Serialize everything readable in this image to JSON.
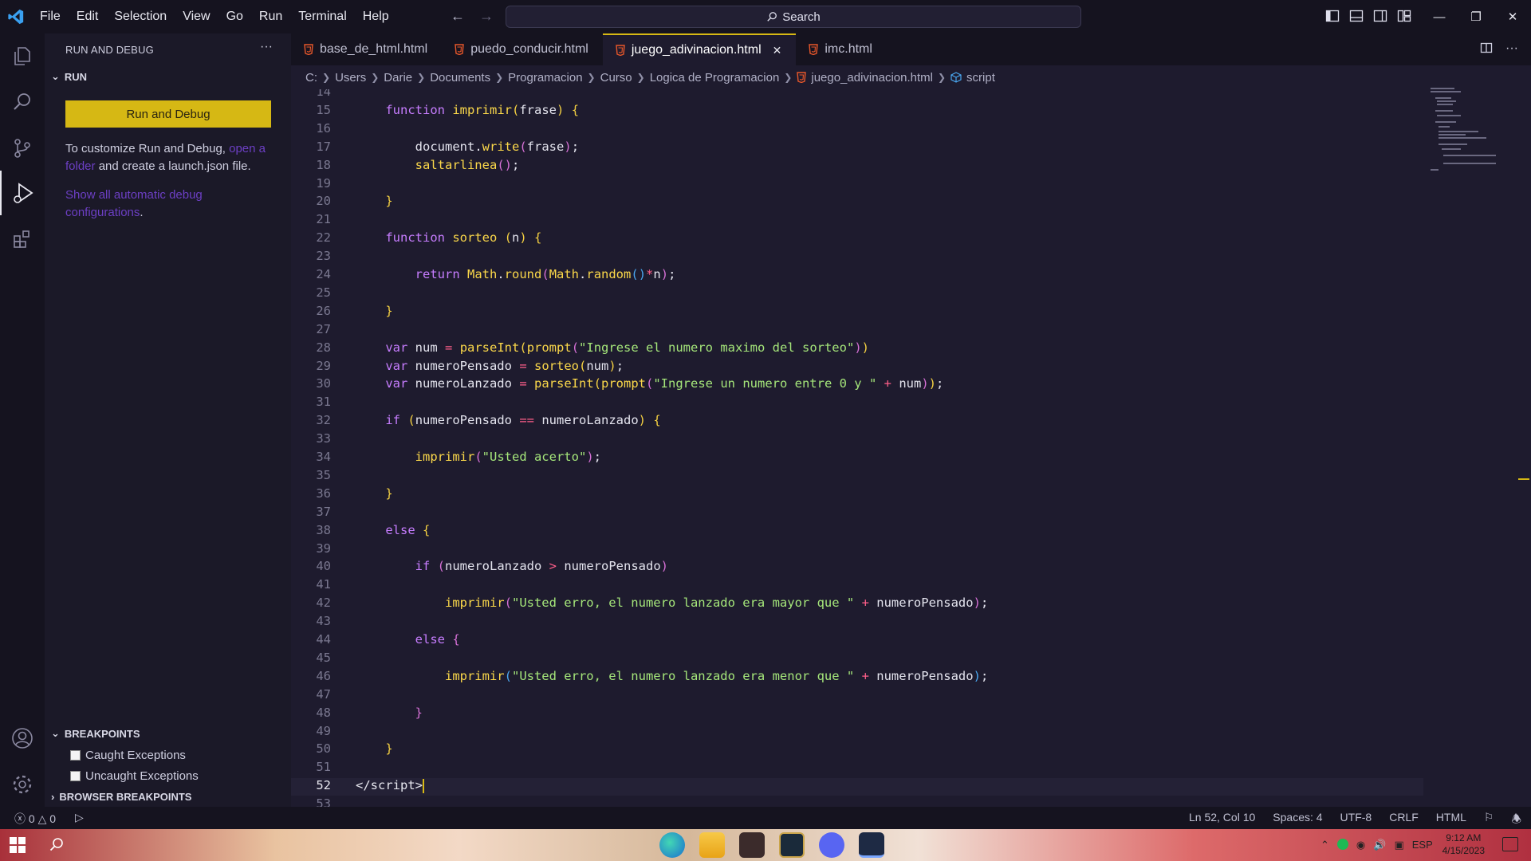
{
  "menu": [
    "File",
    "Edit",
    "Selection",
    "View",
    "Go",
    "Run",
    "Terminal",
    "Help"
  ],
  "search": {
    "label": "Search"
  },
  "sidebar": {
    "title": "RUN AND DEBUG",
    "run_section": "RUN",
    "run_button": "Run and Debug",
    "customize_text_1": "To customize Run and Debug, ",
    "customize_link": "open a folder",
    "customize_text_2": " and create a launch.json file.",
    "show_all_link": "Show all automatic debug configurations",
    "show_all_tail": ".",
    "breakpoints_section": "BREAKPOINTS",
    "caught": "Caught Exceptions",
    "uncaught": "Uncaught Exceptions",
    "browser_breakpoints": "BROWSER BREAKPOINTS"
  },
  "tabs": [
    {
      "label": "base_de_html.html",
      "active": false
    },
    {
      "label": "puedo_conducir.html",
      "active": false
    },
    {
      "label": "juego_adivinacion.html",
      "active": true
    },
    {
      "label": "imc.html",
      "active": false
    }
  ],
  "breadcrumb": [
    "C:",
    "Users",
    "Darie",
    "Documents",
    "Programacion",
    "Curso",
    "Logica de Programacion",
    "juego_adivinacion.html",
    "script"
  ],
  "editor": {
    "lines": [
      {
        "n": "14",
        "html": ""
      },
      {
        "n": "15",
        "html": "    <span class=\"kw\">function</span> <span class=\"fn\">imprimir</span><span class=\"br1\">(</span>frase<span class=\"br1\">)</span> <span class=\"br1\">{</span>"
      },
      {
        "n": "16",
        "html": ""
      },
      {
        "n": "17",
        "html": "        document<span class=\"var\">.</span><span class=\"fn\">write</span><span class=\"br2\">(</span>frase<span class=\"br2\">)</span>;"
      },
      {
        "n": "18",
        "html": "        <span class=\"fn\">saltarlinea</span><span class=\"br2\">()</span>;"
      },
      {
        "n": "19",
        "html": ""
      },
      {
        "n": "20",
        "html": "    <span class=\"br1\">}</span>"
      },
      {
        "n": "21",
        "html": ""
      },
      {
        "n": "22",
        "html": "    <span class=\"kw\">function</span> <span class=\"fn\">sorteo</span> <span class=\"br1\">(</span>n<span class=\"br1\">)</span> <span class=\"br1\">{</span>"
      },
      {
        "n": "23",
        "html": ""
      },
      {
        "n": "24",
        "html": "        <span class=\"kw\">return</span> <span class=\"fn\">Math</span>.<span class=\"fn\">round</span><span class=\"br2\">(</span><span class=\"fn\">Math</span>.<span class=\"fn\">random</span><span class=\"br3\">()</span><span class=\"op\">*</span>n<span class=\"br2\">)</span>;"
      },
      {
        "n": "25",
        "html": ""
      },
      {
        "n": "26",
        "html": "    <span class=\"br1\">}</span>"
      },
      {
        "n": "27",
        "html": ""
      },
      {
        "n": "28",
        "html": "    <span class=\"kw\">var</span> num <span class=\"op\">=</span> <span class=\"fn\">parseInt</span><span class=\"br1\">(</span><span class=\"fn\">prompt</span><span class=\"br2\">(</span><span class=\"str\">\"Ingrese el numero maximo del sorteo\"</span><span class=\"br2\">)</span><span class=\"br1\">)</span>"
      },
      {
        "n": "29",
        "html": "    <span class=\"kw\">var</span> numeroPensado <span class=\"op\">=</span> <span class=\"fn\">sorteo</span><span class=\"br1\">(</span>num<span class=\"br1\">)</span>;"
      },
      {
        "n": "30",
        "html": "    <span class=\"kw\">var</span> numeroLanzado <span class=\"op\">=</span> <span class=\"fn\">parseInt</span><span class=\"br1\">(</span><span class=\"fn\">prompt</span><span class=\"br2\">(</span><span class=\"str\">\"Ingrese un numero entre 0 y \"</span> <span class=\"op\">+</span> num<span class=\"br2\">)</span><span class=\"br1\">)</span>;"
      },
      {
        "n": "31",
        "html": ""
      },
      {
        "n": "32",
        "html": "    <span class=\"kw\">if</span> <span class=\"br1\">(</span>numeroPensado <span class=\"op\">==</span> numeroLanzado<span class=\"br1\">)</span> <span class=\"br1\">{</span>"
      },
      {
        "n": "33",
        "html": ""
      },
      {
        "n": "34",
        "html": "        <span class=\"fn\">imprimir</span><span class=\"br2\">(</span><span class=\"str\">\"Usted acerto\"</span><span class=\"br2\">)</span>;"
      },
      {
        "n": "35",
        "html": ""
      },
      {
        "n": "36",
        "html": "    <span class=\"br1\">}</span>"
      },
      {
        "n": "37",
        "html": ""
      },
      {
        "n": "38",
        "html": "    <span class=\"kw\">else</span> <span class=\"br1\">{</span>"
      },
      {
        "n": "39",
        "html": ""
      },
      {
        "n": "40",
        "html": "        <span class=\"kw\">if</span> <span class=\"br2\">(</span>numeroLanzado <span class=\"op\">&gt;</span> numeroPensado<span class=\"br2\">)</span>"
      },
      {
        "n": "41",
        "html": ""
      },
      {
        "n": "42",
        "html": "            <span class=\"fn\">imprimir</span><span class=\"br2\">(</span><span class=\"str\">\"Usted erro, el numero lanzado era mayor que \"</span> <span class=\"op\">+</span> numeroPensado<span class=\"br2\">)</span>;"
      },
      {
        "n": "43",
        "html": ""
      },
      {
        "n": "44",
        "html": "        <span class=\"kw\">else</span> <span class=\"br2\">{</span>"
      },
      {
        "n": "45",
        "html": ""
      },
      {
        "n": "46",
        "html": "            <span class=\"fn\">imprimir</span><span class=\"br3\">(</span><span class=\"str\">\"Usted erro, el numero lanzado era menor que \"</span> <span class=\"op\">+</span> numeroPensado<span class=\"br3\">)</span>;"
      },
      {
        "n": "47",
        "html": ""
      },
      {
        "n": "48",
        "html": "        <span class=\"br2\">}</span>"
      },
      {
        "n": "49",
        "html": ""
      },
      {
        "n": "50",
        "html": "    <span class=\"br1\">}</span>"
      },
      {
        "n": "51",
        "html": ""
      },
      {
        "n": "52",
        "html": "<span class=\"tag\">&lt;/script&gt;</span><span class=\"cursor\"></span>",
        "current": true
      },
      {
        "n": "53",
        "html": ""
      }
    ]
  },
  "status": {
    "errors": "0",
    "warnings": "0",
    "position": "Ln 52, Col 10",
    "spaces": "Spaces: 4",
    "encoding": "UTF-8",
    "eol": "CRLF",
    "language": "HTML"
  },
  "taskbar": {
    "lang": "ESP",
    "time": "9:12 AM",
    "date": "4/15/2023"
  },
  "colors": {
    "accent": "#d6b814",
    "editor_bg": "#1e1b2e",
    "sidebar_bg": "#1b1928",
    "chrome_bg": "#15131f",
    "link": "#6c3fc4"
  },
  "icons": [
    "vscode-logo-icon",
    "explorer-icon",
    "search-icon",
    "source-control-icon",
    "run-debug-icon",
    "extensions-icon",
    "account-icon",
    "settings-gear-icon",
    "html-file-icon",
    "close-icon",
    "split-editor-icon",
    "more-actions-icon"
  ]
}
